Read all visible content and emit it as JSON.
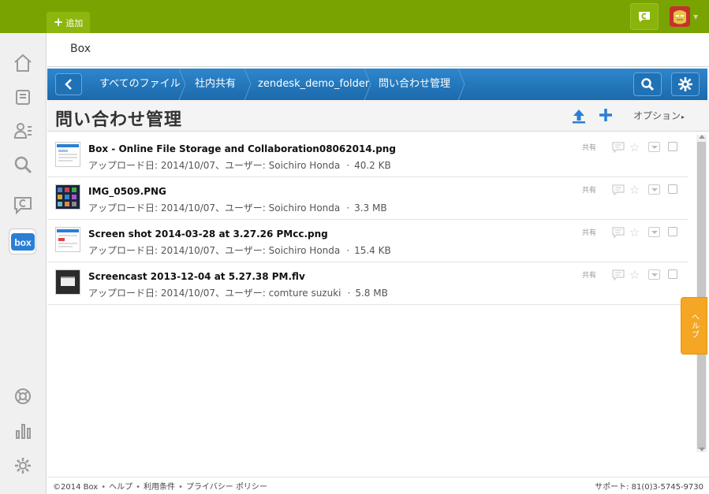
{
  "topbar": {
    "add_label": "追加"
  },
  "app": {
    "title": "Box"
  },
  "breadcrumb": {
    "items": [
      "すべてのファイル",
      "社内共有",
      "zendesk_demo_folder",
      "問い合わせ管理"
    ]
  },
  "folder": {
    "title": "問い合わせ管理",
    "options_label": "オプション"
  },
  "files": [
    {
      "name": "Box - Online File Storage and Collaboration08062014.png",
      "meta": "アップロード日: 2014/10/07、ユーザー: Soichiro Honda",
      "size": "40.2 KB",
      "share": "共有"
    },
    {
      "name": "IMG_0509.PNG",
      "meta": "アップロード日: 2014/10/07、ユーザー: Soichiro Honda",
      "size": "3.3 MB",
      "share": "共有"
    },
    {
      "name": "Screen shot 2014-03-28 at 3.27.26 PMcc.png",
      "meta": "アップロード日: 2014/10/07、ユーザー: Soichiro Honda",
      "size": "15.4 KB",
      "share": "共有"
    },
    {
      "name": "Screencast 2013-12-04 at 5.27.38 PM.flv",
      "meta": "アップロード日: 2014/10/07、ユーザー: comture suzuki",
      "size": "5.8 MB",
      "share": "共有"
    }
  ],
  "feedback": {
    "label": "ヘルプ"
  },
  "footer": {
    "copyright": "©2014 Box",
    "help": "ヘルプ",
    "terms": "利用条件",
    "privacy": "プライバシー ポリシー",
    "support": "サポート: 81(0)3-5745-9730"
  },
  "colors": {
    "topbar": "#78a300",
    "crumbbar": "#1f72b6",
    "feedback": "#f5a623"
  }
}
